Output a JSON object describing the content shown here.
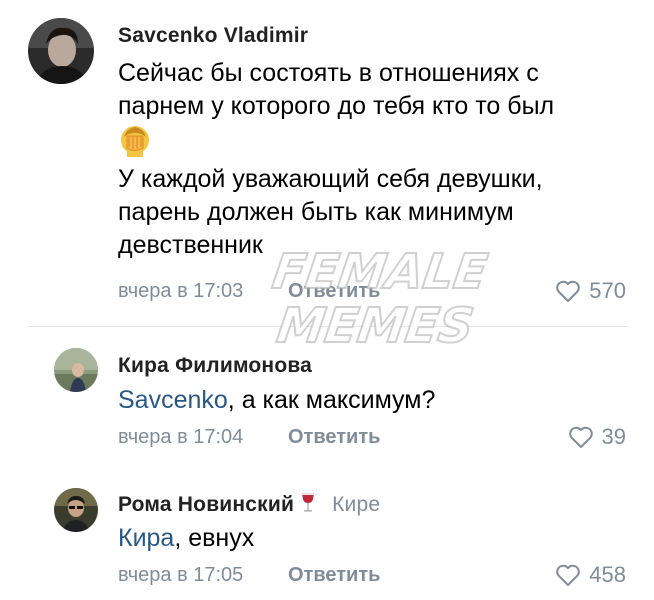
{
  "comments": [
    {
      "author": "Savcenko Vladimir",
      "lines": [
        "Сейчас бы состоять в отношениях с",
        "парнем у которого до тебя кто то был"
      ],
      "emoji": "facepalm-emoji",
      "lines2": [
        "У каждой уважающий себя девушки,",
        "парень должен быть как минимум",
        "девственник"
      ],
      "time": "вчера в 17:03",
      "reply_label": "Ответить",
      "likes": "570"
    },
    {
      "author": "Кира Филимонова",
      "mention": "Savcenko",
      "text": ", а как максимум?",
      "time": "вчера в 17:04",
      "reply_label": "Ответить",
      "likes": "39"
    },
    {
      "author": "Рома Новинский",
      "author_badge": "wine-glass-icon",
      "reply_to": "Кире",
      "mention": "Кира",
      "text": ", евнух",
      "time": "вчера в 17:05",
      "reply_label": "Ответить",
      "likes": "458"
    }
  ],
  "watermark": {
    "line1": "FEMALE",
    "line2": "MEMES"
  },
  "colors": {
    "mention": "#2a5885",
    "meta": "#818c99",
    "divider": "#e4e6ea"
  }
}
